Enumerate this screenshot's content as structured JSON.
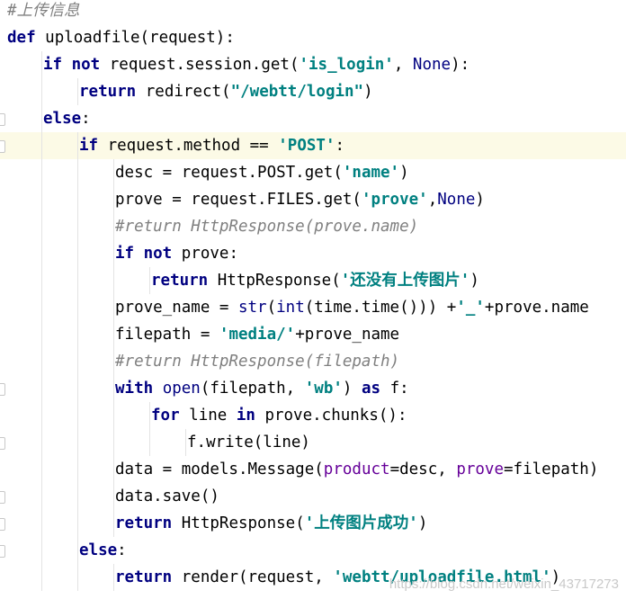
{
  "editor": {
    "current_line_index": 5,
    "fold_markers_lines": [
      4,
      5,
      14,
      16,
      18,
      19,
      20
    ],
    "lines": [
      {
        "indent": 0,
        "tokens": [
          {
            "t": "cmt",
            "v": "#上传信息"
          }
        ]
      },
      {
        "indent": 0,
        "tokens": [
          {
            "t": "kw",
            "v": "def "
          },
          {
            "t": "txt",
            "v": "uploadfile(request):"
          }
        ]
      },
      {
        "indent": 1,
        "tokens": [
          {
            "t": "kw",
            "v": "if not "
          },
          {
            "t": "txt",
            "v": "request.session.get("
          },
          {
            "t": "str",
            "v": "'is_login'"
          },
          {
            "t": "txt",
            "v": ", "
          },
          {
            "t": "bi",
            "v": "None"
          },
          {
            "t": "txt",
            "v": "):"
          }
        ]
      },
      {
        "indent": 2,
        "tokens": [
          {
            "t": "kw",
            "v": "return "
          },
          {
            "t": "txt",
            "v": "redirect("
          },
          {
            "t": "str",
            "v": "\"/webtt/login\""
          },
          {
            "t": "txt",
            "v": ")"
          }
        ]
      },
      {
        "indent": 1,
        "tokens": [
          {
            "t": "kw",
            "v": "else"
          },
          {
            "t": "txt",
            "v": ":"
          }
        ]
      },
      {
        "indent": 2,
        "tokens": [
          {
            "t": "kw",
            "v": "if "
          },
          {
            "t": "txt",
            "v": "request.method == "
          },
          {
            "t": "str",
            "v": "'POST'"
          },
          {
            "t": "txt",
            "v": ":"
          }
        ]
      },
      {
        "indent": 3,
        "tokens": [
          {
            "t": "txt",
            "v": "desc = request.POST.get("
          },
          {
            "t": "str",
            "v": "'name'"
          },
          {
            "t": "txt",
            "v": ")"
          }
        ]
      },
      {
        "indent": 3,
        "tokens": [
          {
            "t": "txt",
            "v": "prove = request.FILES.get("
          },
          {
            "t": "str",
            "v": "'prove'"
          },
          {
            "t": "txt",
            "v": ","
          },
          {
            "t": "bi",
            "v": "None"
          },
          {
            "t": "txt",
            "v": ")"
          }
        ]
      },
      {
        "indent": 3,
        "tokens": [
          {
            "t": "cmt",
            "v": "#return HttpResponse(prove.name)"
          }
        ]
      },
      {
        "indent": 3,
        "tokens": [
          {
            "t": "kw",
            "v": "if not "
          },
          {
            "t": "txt",
            "v": "prove:"
          }
        ]
      },
      {
        "indent": 4,
        "tokens": [
          {
            "t": "kw",
            "v": "return "
          },
          {
            "t": "txt",
            "v": "HttpResponse("
          },
          {
            "t": "str",
            "v": "'还没有上传图片'"
          },
          {
            "t": "txt",
            "v": ")"
          }
        ]
      },
      {
        "indent": 3,
        "tokens": [
          {
            "t": "txt",
            "v": "prove_name = "
          },
          {
            "t": "bi",
            "v": "str"
          },
          {
            "t": "txt",
            "v": "("
          },
          {
            "t": "bi",
            "v": "int"
          },
          {
            "t": "txt",
            "v": "(time.time())) +"
          },
          {
            "t": "str",
            "v": "'_'"
          },
          {
            "t": "txt",
            "v": "+prove.name"
          }
        ]
      },
      {
        "indent": 3,
        "tokens": [
          {
            "t": "txt",
            "v": "filepath = "
          },
          {
            "t": "str",
            "v": "'media/'"
          },
          {
            "t": "txt",
            "v": "+prove_name"
          }
        ]
      },
      {
        "indent": 3,
        "tokens": [
          {
            "t": "cmt",
            "v": "#return HttpResponse(filepath)"
          }
        ]
      },
      {
        "indent": 3,
        "tokens": [
          {
            "t": "kw",
            "v": "with "
          },
          {
            "t": "bi",
            "v": "open"
          },
          {
            "t": "txt",
            "v": "(filepath, "
          },
          {
            "t": "str",
            "v": "'wb'"
          },
          {
            "t": "txt",
            "v": ") "
          },
          {
            "t": "kw",
            "v": "as "
          },
          {
            "t": "txt",
            "v": "f:"
          }
        ]
      },
      {
        "indent": 4,
        "tokens": [
          {
            "t": "kw",
            "v": "for "
          },
          {
            "t": "txt",
            "v": "line "
          },
          {
            "t": "kw",
            "v": "in "
          },
          {
            "t": "txt",
            "v": "prove.chunks():"
          }
        ]
      },
      {
        "indent": 5,
        "tokens": [
          {
            "t": "txt",
            "v": "f.write(line)"
          }
        ]
      },
      {
        "indent": 3,
        "tokens": [
          {
            "t": "txt",
            "v": "data = models.Message("
          },
          {
            "t": "param",
            "v": "product"
          },
          {
            "t": "txt",
            "v": "=desc, "
          },
          {
            "t": "param",
            "v": "prove"
          },
          {
            "t": "txt",
            "v": "=filepath)"
          }
        ]
      },
      {
        "indent": 3,
        "tokens": [
          {
            "t": "txt",
            "v": "data.save()"
          }
        ]
      },
      {
        "indent": 3,
        "tokens": [
          {
            "t": "kw",
            "v": "return "
          },
          {
            "t": "txt",
            "v": "HttpResponse("
          },
          {
            "t": "str",
            "v": "'上传图片成功'"
          },
          {
            "t": "txt",
            "v": ")"
          }
        ]
      },
      {
        "indent": 2,
        "tokens": [
          {
            "t": "kw",
            "v": "else"
          },
          {
            "t": "txt",
            "v": ":"
          }
        ]
      },
      {
        "indent": 3,
        "tokens": [
          {
            "t": "kw",
            "v": "return "
          },
          {
            "t": "txt",
            "v": "render(request, "
          },
          {
            "t": "str",
            "v": "'webtt/uploadfile.html'"
          },
          {
            "t": "txt",
            "v": ")"
          }
        ]
      }
    ]
  },
  "watermark": "https://blog.csdn.net/weixin_43717273"
}
